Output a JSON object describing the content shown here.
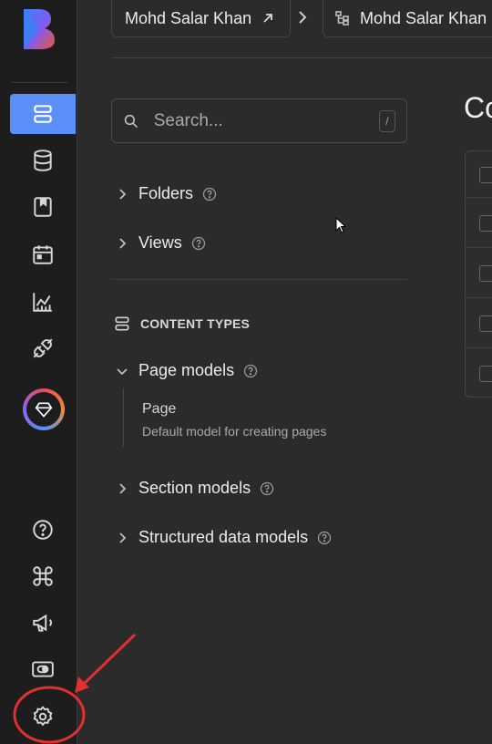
{
  "breadcrumbs": {
    "project": "Mohd Salar Khan",
    "environment": "Mohd Salar Khan"
  },
  "sidebar": {
    "items": [
      {
        "icon": "content-stack-icon",
        "active": true
      },
      {
        "icon": "database-icon"
      },
      {
        "icon": "bookmark-book-icon"
      },
      {
        "icon": "calendar-icon"
      },
      {
        "icon": "analytics-chart-icon"
      },
      {
        "icon": "plug-icon"
      },
      {
        "icon": "diamond-upgrade-icon"
      },
      {
        "icon": "help-circle-icon"
      },
      {
        "icon": "command-icon"
      },
      {
        "icon": "megaphone-icon"
      },
      {
        "icon": "toggle-card-icon"
      },
      {
        "icon": "settings-gear-icon"
      }
    ],
    "active_color": "#5b8ff9"
  },
  "search": {
    "placeholder": "Search...",
    "shortcut": "/"
  },
  "tree": {
    "folders": "Folders",
    "views": "Views",
    "content_types_heading": "CONTENT TYPES",
    "page_models": "Page models",
    "page_item": {
      "title": "Page",
      "description": "Default model for creating pages"
    },
    "section_models": "Section models",
    "structured_models": "Structured data models"
  },
  "main": {
    "title_fragment": "Co"
  },
  "annotation": {
    "color": "#e0302f"
  }
}
